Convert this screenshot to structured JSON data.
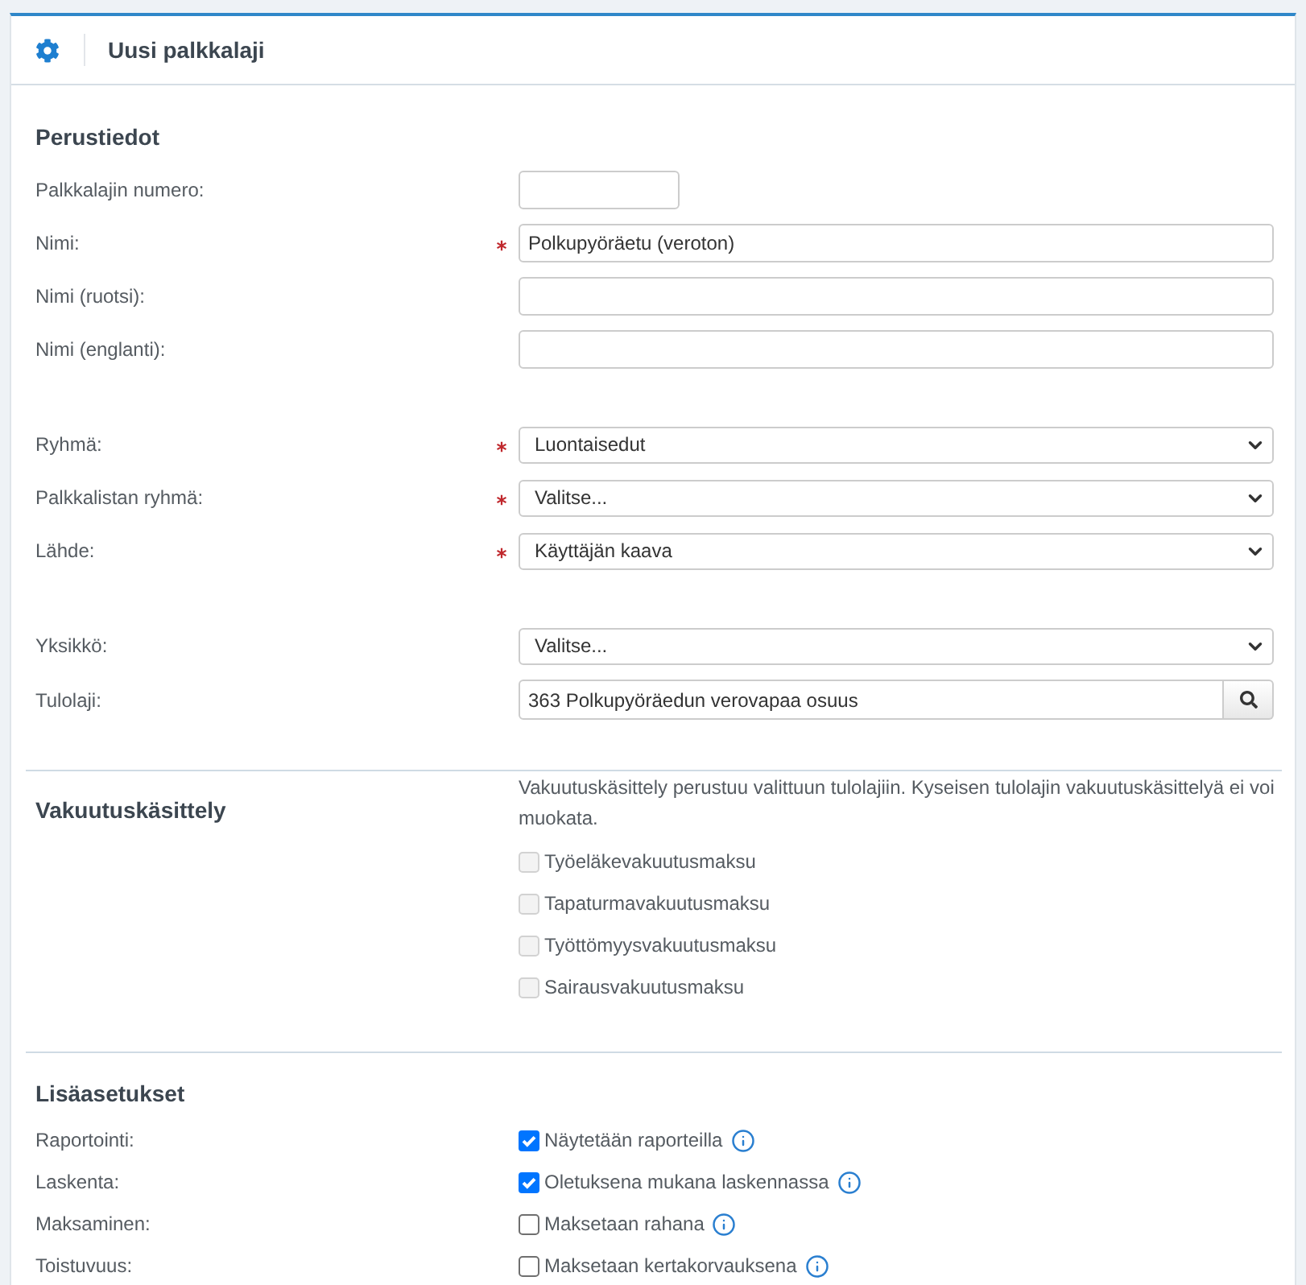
{
  "header": {
    "title": "Uusi palkkalaji"
  },
  "basic": {
    "title": "Perustiedot",
    "groups": [
      [
        {
          "label": "Palkkalajin numero:",
          "kind": "short_input",
          "required": false
        },
        {
          "label": "Nimi:",
          "kind": "input",
          "required": true,
          "value": "Polkupyöräetu (veroton)"
        },
        {
          "label": "Nimi (ruotsi):",
          "kind": "input",
          "required": false
        },
        {
          "label": "Nimi (englanti):",
          "kind": "input",
          "required": false
        }
      ],
      [
        {
          "label": "Ryhmä:",
          "kind": "select",
          "required": true,
          "value": "Luontaisedut"
        },
        {
          "label": "Palkkalistan ryhmä:",
          "kind": "select",
          "required": true,
          "value": "Valitse..."
        },
        {
          "label": "Lähde:",
          "kind": "select",
          "required": true,
          "value": "Käyttäjän kaava"
        }
      ],
      [
        {
          "label": "Yksikkö:",
          "kind": "select",
          "required": false,
          "value": "Valitse..."
        },
        {
          "label": "Tulolaji:",
          "kind": "lookup",
          "required": false,
          "value": "363 Polkupyöräedun verovapaa osuus"
        }
      ]
    ]
  },
  "insurance": {
    "title": "Vakuutuskäsittely",
    "note": "Vakuutuskäsittely perustuu valittuun tulolajiin. Kyseisen tulolajin vakuutuskäsittelyä ei voi muokata.",
    "checkboxes": [
      {
        "label": "Työeläkevakuutusmaksu",
        "checked": false,
        "disabled": true
      },
      {
        "label": "Tapaturmavakuutusmaksu",
        "checked": false,
        "disabled": true
      },
      {
        "label": "Työttömyysvakuutusmaksu",
        "checked": false,
        "disabled": true
      },
      {
        "label": "Sairausvakuutusmaksu",
        "checked": false,
        "disabled": true
      }
    ]
  },
  "additional": {
    "title": "Lisäasetukset",
    "rows": [
      {
        "label": "Raportointi:",
        "option": "Näytetään raporteilla",
        "checked": true
      },
      {
        "label": "Laskenta:",
        "option": "Oletuksena mukana laskennassa",
        "checked": true
      },
      {
        "label": "Maksaminen:",
        "option": "Maksetaan rahana",
        "checked": false
      },
      {
        "label": "Toistuvuus:",
        "option": "Maksetaan kertakorvauksena",
        "checked": false
      }
    ]
  }
}
